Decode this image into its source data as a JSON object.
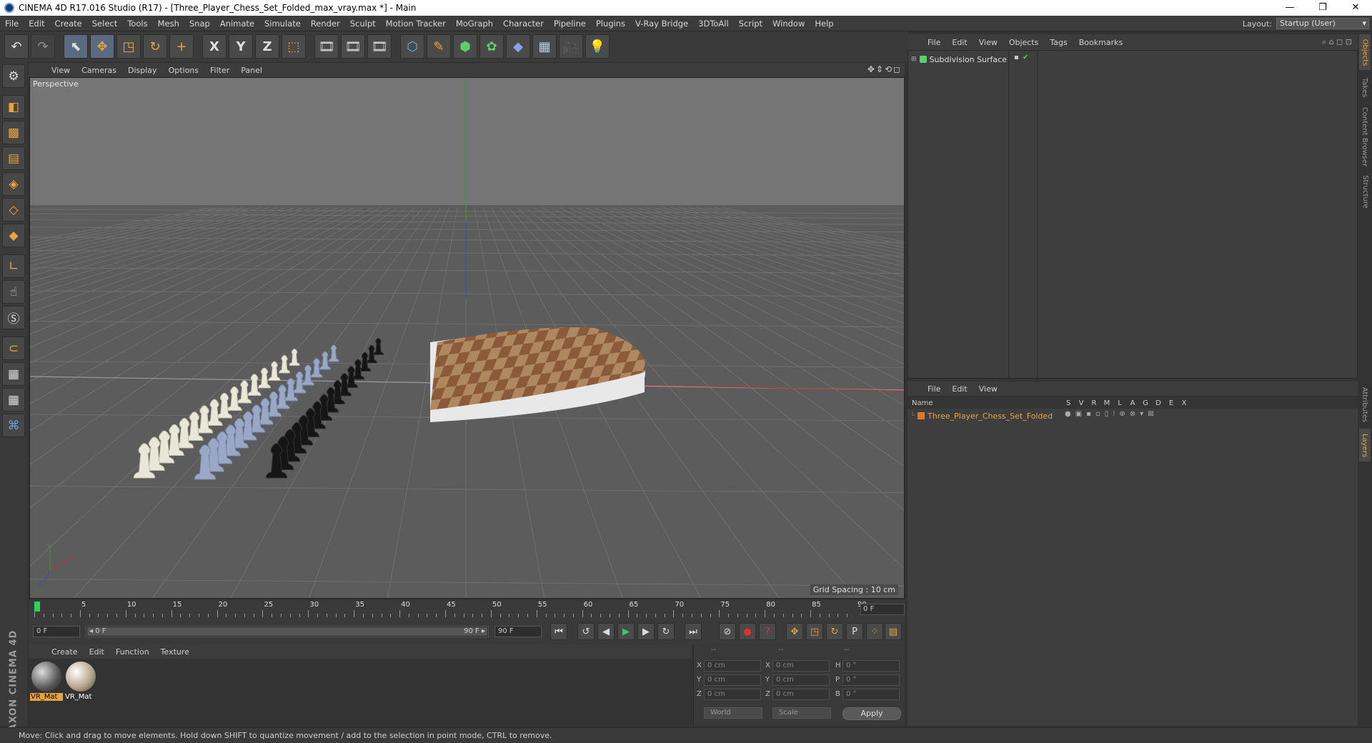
{
  "window": {
    "title": "CINEMA 4D R17.016 Studio (R17) - [Three_Player_Chess_Set_Folded_max_vray.max *] - Main",
    "minimize": "—",
    "restore": "❐",
    "close": "✕"
  },
  "menubar": {
    "items": [
      "File",
      "Edit",
      "Create",
      "Select",
      "Tools",
      "Mesh",
      "Snap",
      "Animate",
      "Simulate",
      "Render",
      "Sculpt",
      "Motion Tracker",
      "MoGraph",
      "Character",
      "Pipeline",
      "Plugins",
      "V-Ray Bridge",
      "3DToAll",
      "Script",
      "Window",
      "Help"
    ],
    "layout_label": "Layout:",
    "layout_value": "Startup (User)"
  },
  "toolbar": {
    "undo": "↶",
    "redo": "↷",
    "live_select": "⬉",
    "move": "✥",
    "scale": "◳",
    "rotate": "↻",
    "add": "+",
    "x_axis": "X",
    "y_axis": "Y",
    "z_axis": "Z",
    "world": "⬚",
    "render_view": "🎞",
    "render_picture": "🎞",
    "render_settings": "🎞",
    "cube": "⬡",
    "pen": "✎",
    "subdiv": "⬢",
    "cloner": "✿",
    "deformer": "◆",
    "floor": "▦",
    "camera": "🎥",
    "light": "💡"
  },
  "viewport": {
    "menu": [
      "View",
      "Cameras",
      "Display",
      "Options",
      "Filter",
      "Panel"
    ],
    "label": "Perspective",
    "grid_spacing": "Grid Spacing : 10 cm",
    "nav_icons": "✥⇕⟲◻",
    "axis_y": "y",
    "axis_x": "x",
    "axis_z": "z"
  },
  "timeline": {
    "ticks": [
      "0",
      "5",
      "10",
      "15",
      "20",
      "25",
      "30",
      "35",
      "40",
      "45",
      "50",
      "55",
      "60",
      "65",
      "70",
      "75",
      "80",
      "85",
      "90"
    ],
    "current_frame": "0 F"
  },
  "transport": {
    "start_field": "0 F",
    "range_start": "◂ 0 F",
    "range_end": "90 F ▸",
    "end_field": "90 F",
    "go_start": "⏮",
    "prev_key": "↺",
    "prev_frame": "◀",
    "play": "▶",
    "next_frame": "▶",
    "next_key": "↻",
    "go_end": "⏭",
    "record_lock": "⊘",
    "record": "●",
    "autokey": "?",
    "key_move": "✥",
    "key_scale": "◳",
    "key_rotate": "↻",
    "key_param": "P",
    "key_pla": "⁘",
    "timeline_btn": "▤"
  },
  "materials": {
    "menu": [
      "Create",
      "Edit",
      "Function",
      "Texture"
    ],
    "items": [
      {
        "name": "VR_Mat",
        "color": "#8a8a8a"
      },
      {
        "name": "VR_Mat",
        "color": "#b8a890"
      }
    ]
  },
  "coordinates": {
    "headers": [
      "--",
      "--",
      "--"
    ],
    "rows": [
      {
        "l1": "X",
        "v1": "0 cm",
        "l2": "X",
        "v2": "0 cm",
        "l3": "H",
        "v3": "0 °"
      },
      {
        "l1": "Y",
        "v1": "0 cm",
        "l2": "Y",
        "v2": "0 cm",
        "l3": "P",
        "v3": "0 °"
      },
      {
        "l1": "Z",
        "v1": "0 cm",
        "l2": "Z",
        "v2": "0 cm",
        "l3": "B",
        "v3": "0 °"
      }
    ],
    "mode": "World",
    "scale_mode": "Scale",
    "apply": "Apply"
  },
  "objects": {
    "menu": [
      "File",
      "Edit",
      "View",
      "Objects",
      "Tags",
      "Bookmarks"
    ],
    "items": [
      {
        "name": "Subdivision Surface"
      }
    ],
    "toolbar_icons": "⌕ ⌂ ◻ ⊡"
  },
  "layers": {
    "menu": [
      "File",
      "Edit",
      "View"
    ],
    "columns": [
      "Name",
      "S",
      "V",
      "R",
      "M",
      "L",
      "A",
      "G",
      "D",
      "E",
      "X"
    ],
    "items": [
      {
        "name": "Three_Player_Chess_Set_Folded",
        "color": "#e07a20"
      }
    ]
  },
  "right_tabs": [
    "Objects",
    "Takes",
    "Content Browser",
    "Structure",
    "Attributes",
    "Layers"
  ],
  "status": "Move: Click and drag to move elements. Hold down SHIFT to quantize movement / add to the selection in point mode, CTRL to remove.",
  "brand": "MAXON CINEMA 4D",
  "colors": {
    "accent": "#e8a43c",
    "axis_x": "#c03030",
    "axis_y": "#30a030",
    "axis_z": "#3050c0"
  }
}
